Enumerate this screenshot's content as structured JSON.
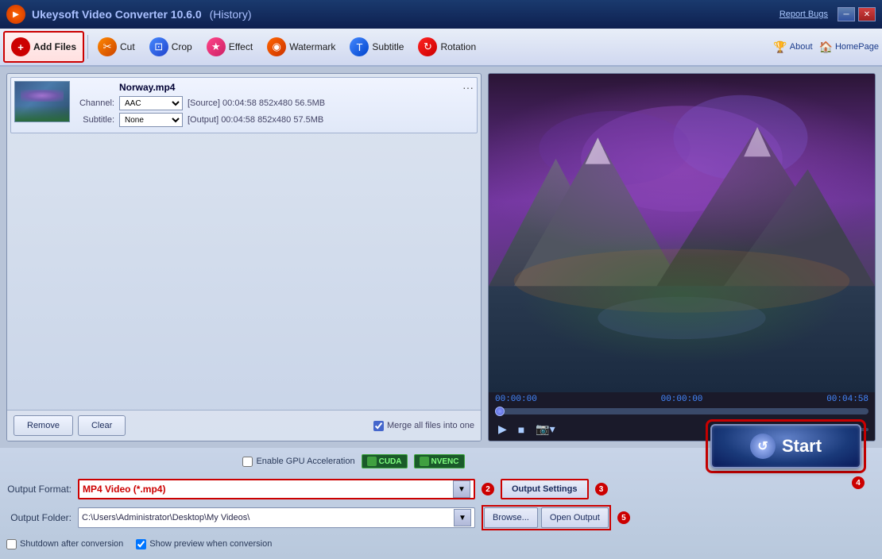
{
  "titlebar": {
    "title": "Ukeysoft Video Converter 10.6.0",
    "history": "(History)",
    "report_bugs": "Report Bugs",
    "minimize": "─",
    "close": "✕"
  },
  "toolbar": {
    "add_files": "Add Files",
    "cut": "Cut",
    "crop": "Crop",
    "effect": "Effect",
    "watermark": "Watermark",
    "subtitle": "Subtitle",
    "rotation": "Rotation",
    "about": "About",
    "homepage": "HomePage"
  },
  "file_item": {
    "channel_label": "Channel:",
    "channel_value": "AAC",
    "subtitle_label": "Subtitle:",
    "subtitle_value": "None",
    "filename": "Norway.mp4",
    "source_info": "[Source]  00:04:58  852x480  56.5MB",
    "output_info": "[Output]  00:04:58  852x480  57.5MB"
  },
  "file_buttons": {
    "remove": "Remove",
    "clear": "Clear",
    "merge_label": "Merge all files into one"
  },
  "preview": {
    "time_start": "00:00:00",
    "time_mid": "00:00:00",
    "time_end": "00:04:58"
  },
  "gpu": {
    "label": "Enable GPU Acceleration",
    "cuda": "CUDA",
    "nvenc": "NVENC"
  },
  "output_format": {
    "label": "Output Format:",
    "value": "MP4 Video (*.mp4)",
    "badge": "2"
  },
  "output_settings": {
    "label": "Output Settings",
    "badge": "3"
  },
  "output_folder": {
    "label": "Output Folder:",
    "value": "C:\\Users\\Administrator\\Desktop\\My Videos\\",
    "badge": "5"
  },
  "buttons": {
    "browse": "Browse...",
    "open_output": "Open Output"
  },
  "options": {
    "shutdown": "Shutdown after conversion",
    "preview": "Show preview when conversion"
  },
  "start": {
    "label": "Start",
    "badge": "4"
  }
}
